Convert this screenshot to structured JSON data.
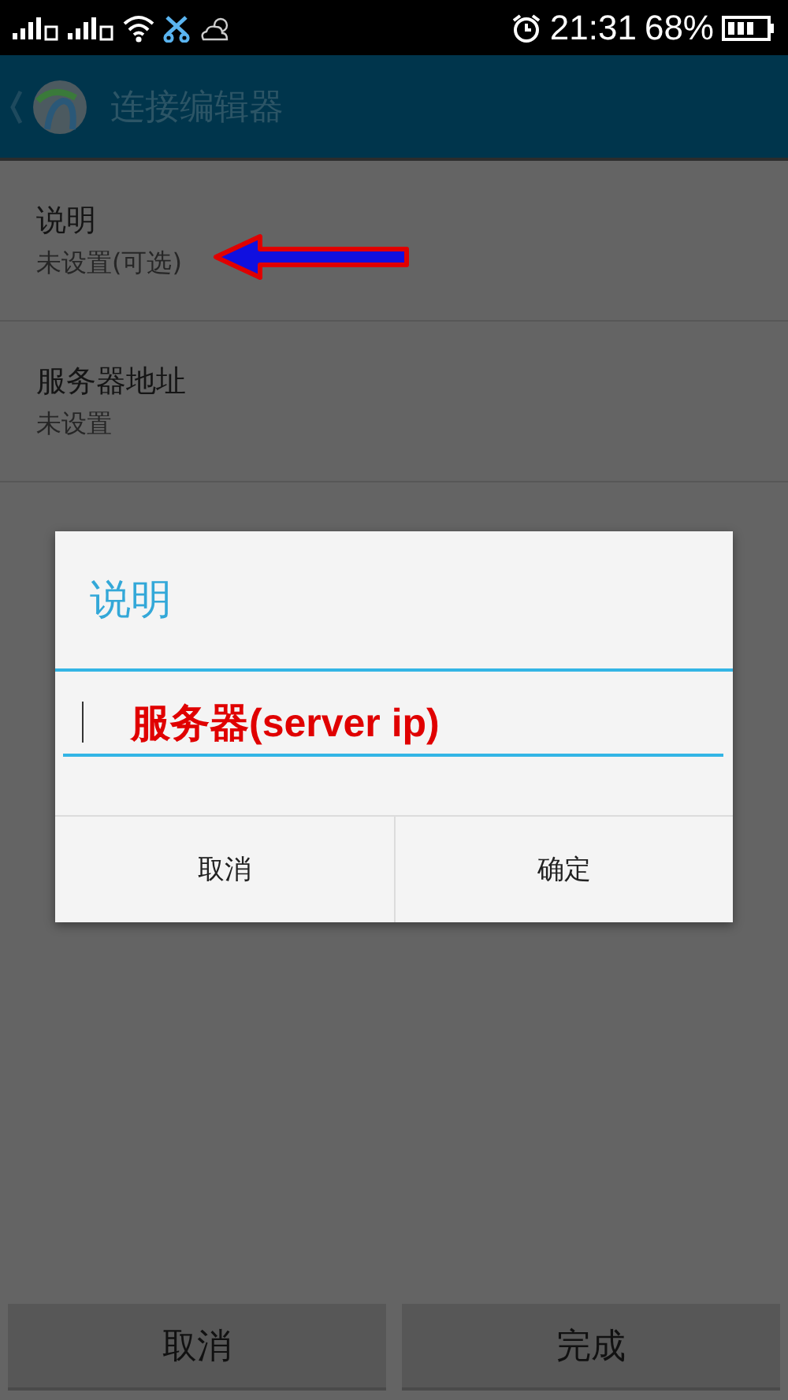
{
  "status_bar": {
    "time": "21:31",
    "battery": "68%"
  },
  "action_bar": {
    "title": "连接编辑器"
  },
  "settings": [
    {
      "title": "说明",
      "summary": "未设置(可选)",
      "annotated": true
    },
    {
      "title": "服务器地址",
      "summary": "未设置",
      "annotated": false
    }
  ],
  "dialog": {
    "title": "说明",
    "annotation": "服务器(server ip)",
    "buttons": [
      "取消",
      "确定"
    ]
  },
  "bottom_buttons": [
    "取消",
    "完成"
  ]
}
